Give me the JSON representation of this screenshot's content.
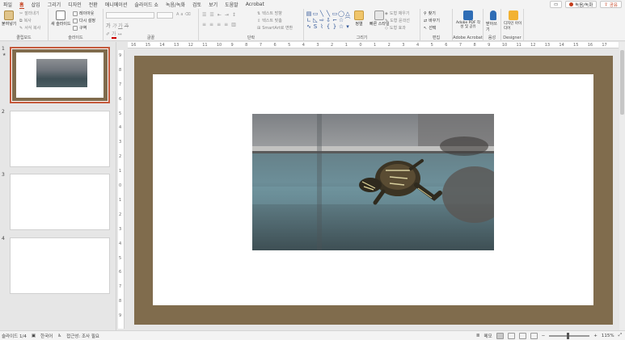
{
  "menu": {
    "tabs": [
      "파일",
      "홈",
      "삽입",
      "그리기",
      "디자인",
      "전환",
      "애니메이션",
      "슬라이드 쇼",
      "녹음/녹화",
      "검토",
      "보기",
      "도움말",
      "Acrobat"
    ],
    "active_tab": "홈",
    "record_button": "녹음/녹화",
    "share_button": "공유"
  },
  "ribbon": {
    "clipboard": {
      "paste": "붙여넣기",
      "cut": "잘라내기",
      "copy": "복사",
      "format_painter": "서식 복사",
      "label": "클립보드"
    },
    "slides": {
      "new_slide": "새 슬라이드",
      "layout": "레이아웃",
      "reset": "다시 설정",
      "section": "구역",
      "label": "슬라이드"
    },
    "font": {
      "label": "글꼴"
    },
    "paragraph": {
      "text_direction": "텍스트 방향",
      "align_text": "텍스트 맞춤",
      "smartart": "SmartArt로 변환",
      "label": "단락"
    },
    "drawing": {
      "arrange": "정렬",
      "quick_styles": "빠른 스타일",
      "shape_fill": "도형 채우기",
      "shape_outline": "도형 윤곽선",
      "shape_effects": "도형 효과",
      "label": "그리기"
    },
    "editing": {
      "find": "찾기",
      "replace": "바꾸기",
      "select": "선택",
      "label": "편집"
    },
    "acrobat": {
      "create_pdf": "Adobe PDF 작성 및 공유",
      "label": "Adobe Acrobat"
    },
    "voice": {
      "dictate": "받아쓰기",
      "label": "음성"
    },
    "designer": {
      "design_ideas": "디자인 아이디어",
      "label": "Designer"
    }
  },
  "thumbnails": [
    {
      "num": "1",
      "selected": true
    },
    {
      "num": "2",
      "selected": false
    },
    {
      "num": "3",
      "selected": false
    },
    {
      "num": "4",
      "selected": false
    }
  ],
  "ruler": {
    "h_ticks": [
      "16",
      "15",
      "14",
      "13",
      "12",
      "11",
      "10",
      "9",
      "8",
      "7",
      "6",
      "5",
      "4",
      "3",
      "2",
      "1",
      "0",
      "1",
      "2",
      "3",
      "4",
      "5",
      "6",
      "7",
      "8",
      "9",
      "10",
      "11",
      "12",
      "13",
      "14",
      "15",
      "16",
      "17"
    ],
    "v_ticks": [
      "9",
      "8",
      "7",
      "6",
      "5",
      "4",
      "3",
      "2",
      "1",
      "0",
      "1",
      "2",
      "3",
      "4",
      "5",
      "6",
      "7",
      "8",
      "9"
    ]
  },
  "colors": {
    "accent": "#c43e1c",
    "slide_border": "#806c4d"
  },
  "statusbar": {
    "slide_info": "슬라이드 1/4",
    "language": "한국어",
    "accessibility": "접근성: 조사 필요",
    "notes": "메모",
    "zoom": "115%"
  }
}
